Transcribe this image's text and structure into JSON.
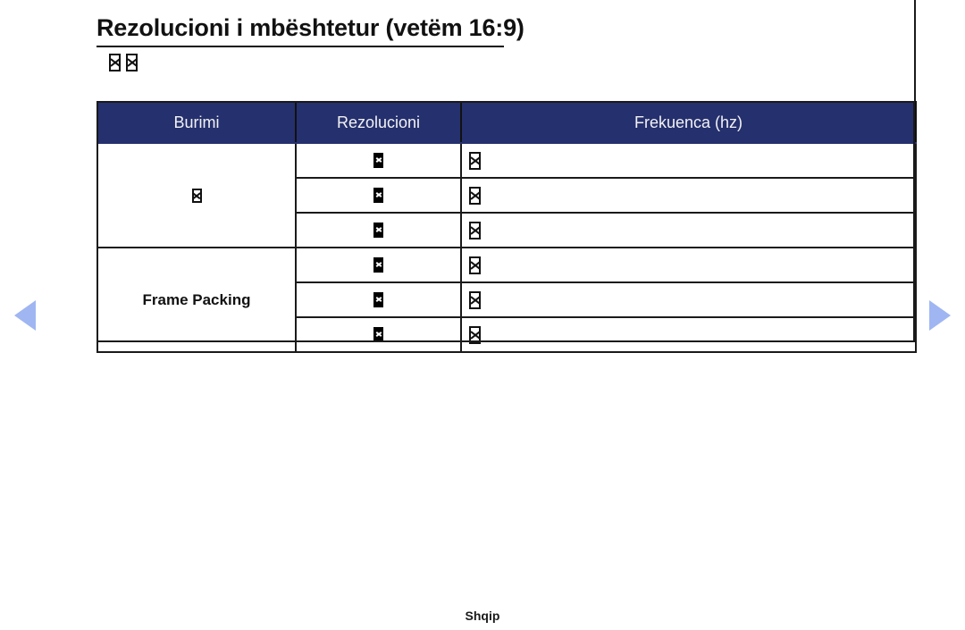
{
  "page": {
    "language_footer": "Shqip"
  },
  "heading": {
    "title": "Rezolucioni i mbështetur (vetëm 16:9)",
    "subline_glyphs": [
      "missing-glyph",
      "missing-glyph"
    ]
  },
  "navigation": {
    "prev_label": "◀",
    "next_label": "▶",
    "prev_icon": "triangle-left-icon",
    "next_icon": "triangle-right-icon",
    "arrow_color": "#9fb6f2"
  },
  "table": {
    "header_bg": "#25306e",
    "header_text_color": "#f2f2f2",
    "columns": [
      {
        "key": "source",
        "label": "Burimi"
      },
      {
        "key": "resolution",
        "label": "Rezolucioni"
      },
      {
        "key": "frequency",
        "label": "Frekuenca (hz)"
      }
    ],
    "groups": [
      {
        "source": "",
        "source_glyph": "missing-glyph",
        "rows": [
          {
            "resolution": "",
            "resolution_glyph": "missing-glyph",
            "frequency": "",
            "frequency_glyph": "missing-glyph",
            "separator": "solid"
          },
          {
            "resolution": "",
            "resolution_glyph": "missing-glyph",
            "frequency": "",
            "frequency_glyph": "missing-glyph",
            "separator": "solid"
          },
          {
            "resolution": "",
            "resolution_glyph": "missing-glyph",
            "frequency": "",
            "frequency_glyph": "missing-glyph",
            "separator": "dotted"
          }
        ]
      },
      {
        "source": "Frame Packing",
        "source_glyph": null,
        "rows": [
          {
            "resolution": "",
            "resolution_glyph": "missing-glyph",
            "frequency": "",
            "frequency_glyph": "missing-glyph",
            "separator": "solid"
          },
          {
            "resolution": "",
            "resolution_glyph": "missing-glyph",
            "frequency": "",
            "frequency_glyph": "missing-glyph",
            "separator": "solid"
          },
          {
            "resolution": "",
            "resolution_glyph": "missing-glyph",
            "frequency": "",
            "frequency_glyph": "missing-glyph",
            "separator": "thin"
          }
        ]
      }
    ]
  }
}
